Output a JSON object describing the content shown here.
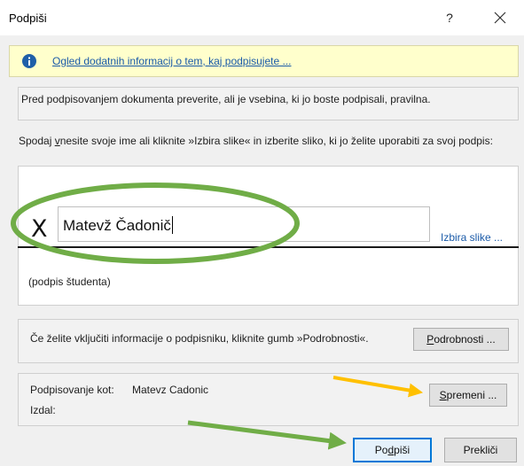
{
  "window": {
    "title": "Podpiši",
    "help_label": "?"
  },
  "info_bar": {
    "link_text": "Ogled dodatnih informacij o tem, kaj podpisujete ..."
  },
  "verify_notice": "Pred podpisovanjem dokumenta preverite, ali je vsebina, ki jo boste podpisali, pravilna.",
  "instructions": {
    "before": "Spodaj ",
    "accel": "v",
    "after": "nesite svoje ime ali kliknite »Izbira slike« in izberite sliko, ki jo želite uporabiti za svoj podpis:"
  },
  "signature": {
    "x_mark": "X",
    "name_value": "Matevž Čadonič",
    "select_image_label": "Izbira slike ...",
    "role": "(podpis študenta)"
  },
  "details_panel": {
    "text": "Če želite vključiti informacije o podpisniku, kliknite gumb »Podrobnosti«.",
    "button_accel": "P",
    "button_rest": "odrobnosti ..."
  },
  "signing_panel": {
    "signing_as_label": "Podpisovanje kot:",
    "signing_as_value": "Matevz Cadonic",
    "issued_by_label": "Izdal:",
    "change_accel": "S",
    "change_rest": "premeni ..."
  },
  "footer": {
    "sign_before": "Po",
    "sign_accel": "d",
    "sign_after": "piši",
    "cancel_label": "Prekliči"
  },
  "annotation_colors": {
    "ellipse": "#70ad47",
    "arrow_sign": "#70ad47",
    "arrow_change": "#ffc000"
  }
}
